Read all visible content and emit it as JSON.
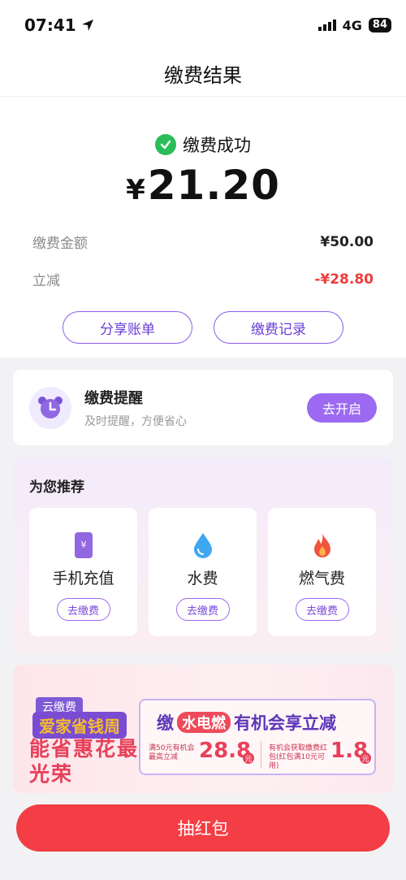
{
  "status_bar": {
    "time": "07:41",
    "network": "4G",
    "battery": "84"
  },
  "nav": {
    "title": "缴费结果"
  },
  "result": {
    "status": "缴费成功",
    "amount_symbol": "¥",
    "amount_value": "21.20",
    "rows": [
      {
        "label": "缴费金额",
        "value": "¥50.00"
      },
      {
        "label": "立减",
        "value": "-¥28.80"
      }
    ],
    "share_button": "分享账单",
    "records_button": "缴费记录"
  },
  "reminder": {
    "title": "缴费提醒",
    "subtitle": "及时提醒，方便省心",
    "button": "去开启"
  },
  "recommend": {
    "title": "为您推荐",
    "items": [
      {
        "name": "手机充值",
        "button": "去缴费",
        "icon": "phone-recharge-icon"
      },
      {
        "name": "水费",
        "button": "去缴费",
        "icon": "water-drop-icon"
      },
      {
        "name": "燃气费",
        "button": "去缴费",
        "icon": "flame-icon"
      }
    ]
  },
  "banner": {
    "tag": "云缴费",
    "week": "爱家省钱周",
    "slogan": "能省惠花最光荣",
    "head_prefix": "缴",
    "head_highlight": "水电燃",
    "head_suffix": "有机会享立减",
    "offer1_text": "满50元有机会最高立减",
    "offer1_value": "28.8",
    "offer1_unit": "元",
    "offer2_text": "有机会获取缴费红包(红包满10元可用)",
    "offer2_value": "1.8",
    "offer2_unit": "元"
  },
  "bottom_button": "抽红包",
  "colors": {
    "accent": "#9b6af0",
    "success": "#2bbd5a",
    "red": "#f43d44"
  }
}
